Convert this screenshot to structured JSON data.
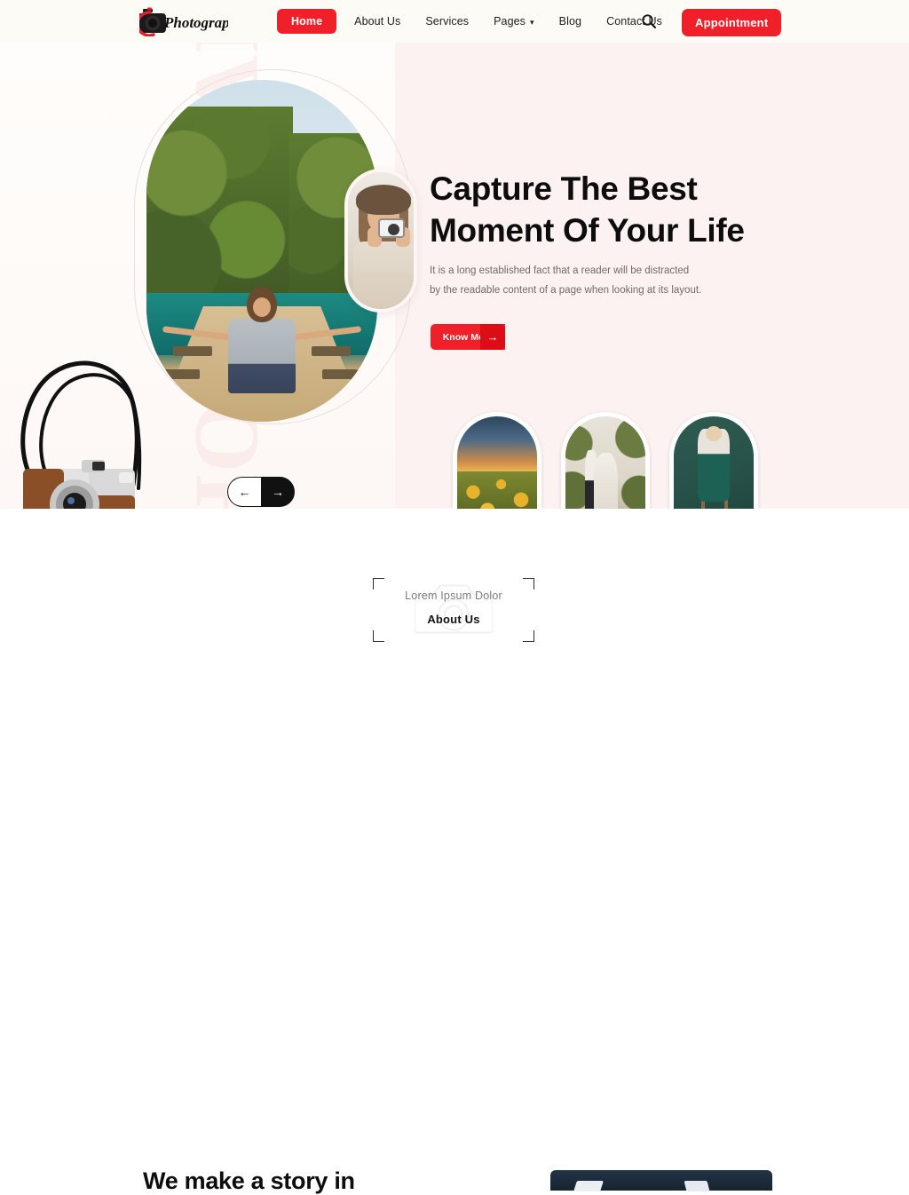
{
  "brand": {
    "name": "Photography",
    "logo_icon": "camera-logo-icon"
  },
  "colors": {
    "accent": "#f0202a",
    "accent_dark": "#dc0d15",
    "hero_bg": "#fdf2f2",
    "navbar_bg": "#fdfbf6",
    "text_dark": "#0d0d0d",
    "text_muted": "#6f6a6a"
  },
  "nav": {
    "items": [
      {
        "label": "Home",
        "active": true
      },
      {
        "label": "About Us",
        "active": false
      },
      {
        "label": "Services",
        "active": false
      },
      {
        "label": "Pages",
        "active": false,
        "has_dropdown": true,
        "caret": "▾"
      },
      {
        "label": "Blog",
        "active": false
      },
      {
        "label": "Contact Us",
        "active": false
      }
    ],
    "search_icon": "search-icon",
    "cta_label": "Appointment"
  },
  "hero": {
    "watermark": "PHOTOGRAPHY",
    "title_line1": "Capture The Best",
    "title_line2": "Moment Of Your Life",
    "description_line1": "It is a long established fact that a reader will be distracted",
    "description_line2": "by the readable content of a page when looking at its layout.",
    "cta_label": "Know More",
    "cta_arrow": "→",
    "main_image_alt": "woman-sitting-on-boat",
    "inset_image_alt": "woman-holding-camera",
    "thumbnails": [
      {
        "alt": "sunflower-field-at-sunset"
      },
      {
        "alt": "wedding-couple-under-floral-arch"
      },
      {
        "alt": "woman-in-green-outfit-on-chair"
      }
    ],
    "slider": {
      "prev_arrow": "←",
      "next_arrow": "→"
    },
    "prop_image_alt": "vintage-camera-with-strap"
  },
  "about": {
    "subtitle": "Lorem Ipsum Dolor",
    "title": "About Us",
    "watermark_icon": "camera-outline-icon",
    "story_heading": "We make a story in",
    "story_image_alt": "dark-camera-lens"
  }
}
